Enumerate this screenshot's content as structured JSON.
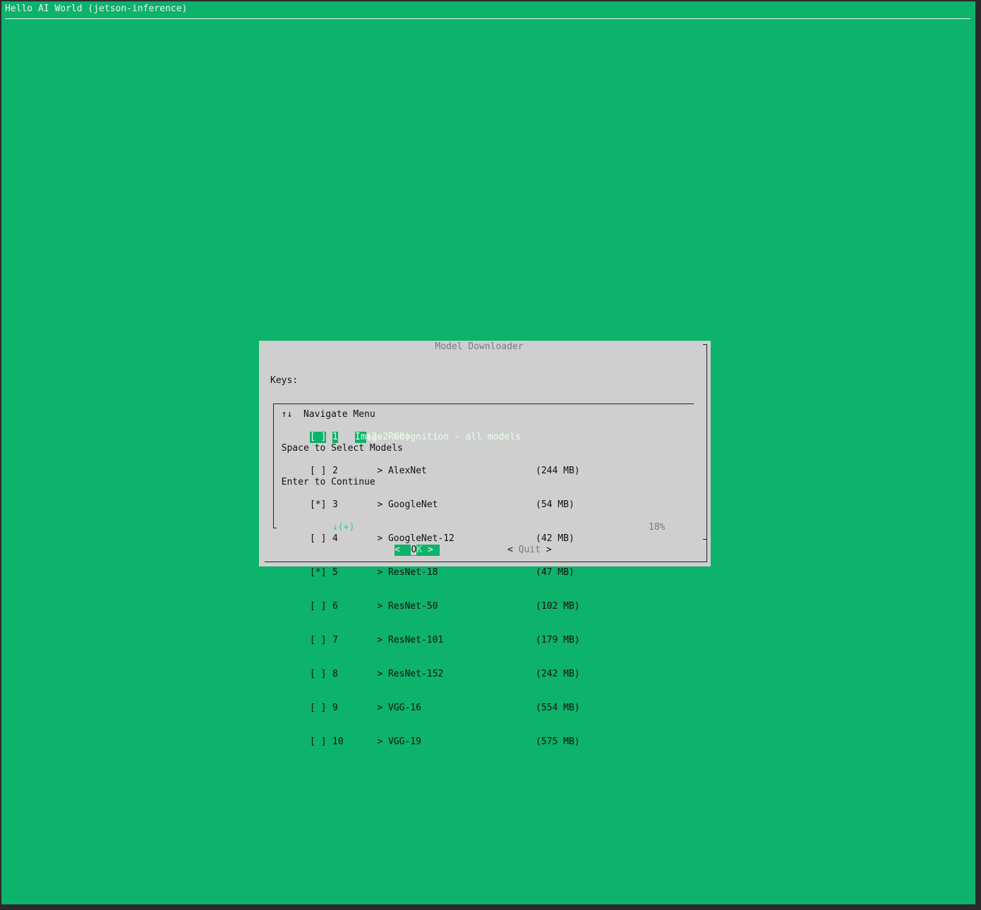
{
  "backtitle": "Hello AI World (jetson-inference)",
  "dialog": {
    "title": "Model Downloader",
    "keys_header": "Keys:",
    "keys": [
      "↑↓  Navigate Menu",
      "Space to Select Models",
      "Enter to Continue"
    ]
  },
  "models": [
    {
      "check": "[ ]",
      "num": "1",
      "name": "Image Recognition - all models",
      "size": "(2.2 GB)"
    },
    {
      "check": "[ ]",
      "num": "2",
      "name": "> AlexNet",
      "size": "(244 MB)"
    },
    {
      "check": "[*]",
      "num": "3",
      "name": "> GoogleNet",
      "size": "(54 MB)"
    },
    {
      "check": "[ ]",
      "num": "4",
      "name": "> GoogleNet-12",
      "size": "(42 MB)"
    },
    {
      "check": "[*]",
      "num": "5",
      "name": "> ResNet-18",
      "size": "(47 MB)"
    },
    {
      "check": "[ ]",
      "num": "6",
      "name": "> ResNet-50",
      "size": "(102 MB)"
    },
    {
      "check": "[ ]",
      "num": "7",
      "name": "> ResNet-101",
      "size": "(179 MB)"
    },
    {
      "check": "[ ]",
      "num": "8",
      "name": "> ResNet-152",
      "size": "(242 MB)"
    },
    {
      "check": "[ ]",
      "num": "9",
      "name": "> VGG-16",
      "size": "(554 MB)"
    },
    {
      "check": "[ ]",
      "num": "10",
      "name": "> VGG-19",
      "size": "(575 MB)"
    }
  ],
  "list_footer": {
    "more": "↓(+)",
    "percent": "18%"
  },
  "buttons": {
    "ok_left": "< ",
    "ok_o": "O",
    "ok_k": "K",
    "ok_right": " >",
    "quit_left": "< ",
    "quit_label": "Quit",
    "quit_right": " >"
  },
  "colors": {
    "terminal_bg": "#0db26b",
    "dialog_bg": "#cfcfcf",
    "highlight": "#0db26b"
  }
}
